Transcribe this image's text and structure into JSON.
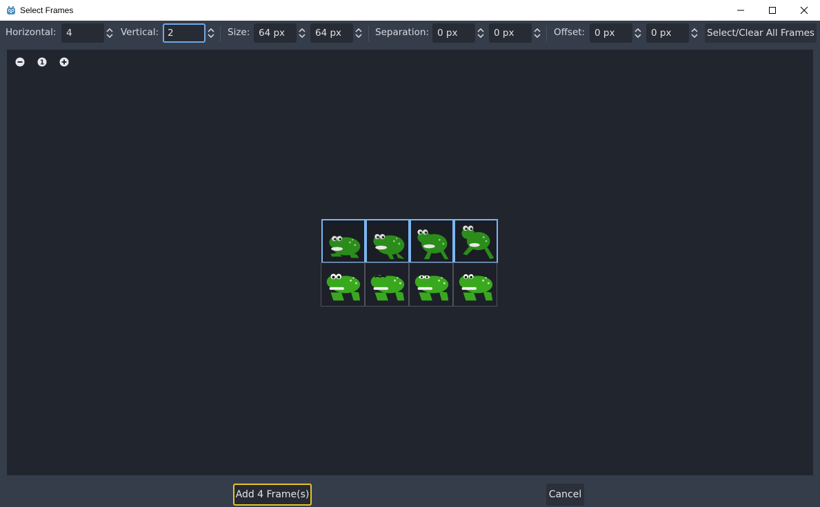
{
  "window": {
    "title": "Select Frames",
    "app_icon": "godot-icon"
  },
  "toolbar": {
    "horizontal_label": "Horizontal:",
    "horizontal_value": "4",
    "vertical_label": "Vertical:",
    "vertical_value": "2",
    "size_label": "Size:",
    "size_x": "64 px",
    "size_y": "64 px",
    "separation_label": "Separation:",
    "separation_x": "0 px",
    "separation_y": "0 px",
    "offset_label": "Offset:",
    "offset_x": "0 px",
    "offset_y": "0 px",
    "select_clear_label": "Select/Clear All Frames"
  },
  "canvas": {
    "zoom_out_icon": "zoom-out-icon",
    "zoom_reset_label": "1",
    "zoom_in_icon": "zoom-in-icon",
    "grid_columns": 4,
    "grid_rows": 2,
    "selected_frames": 4,
    "selection_color": "#7bb6f3"
  },
  "footer": {
    "add_label": "Add 4 Frame(s)",
    "cancel_label": "Cancel",
    "accent_color": "#e6c32d"
  }
}
